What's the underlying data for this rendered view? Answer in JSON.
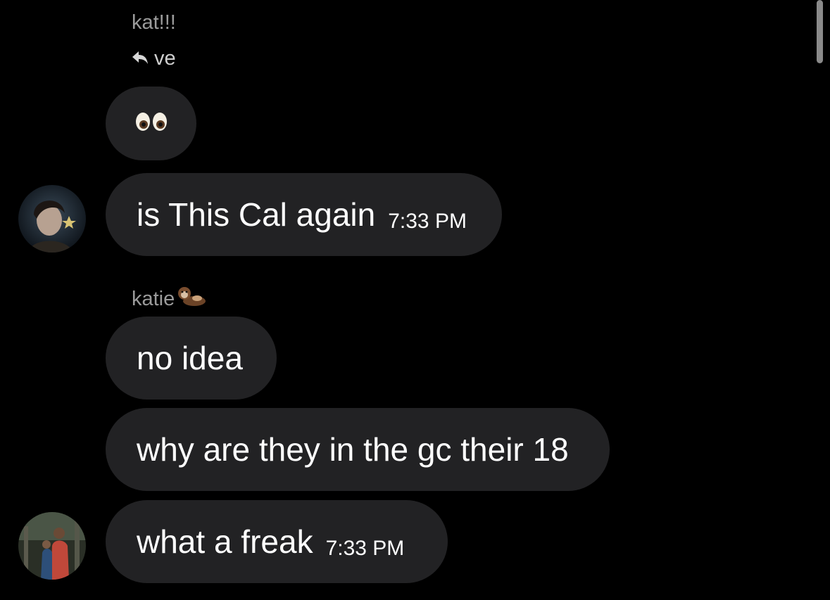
{
  "messages": [
    {
      "sender": "kat!!!",
      "reply_to": "ve",
      "reply_icon": "reply-arrow-icon",
      "text": "👀"
    },
    {
      "text": "is This Cal again",
      "time": "7:33 PM"
    },
    {
      "sender": "katie",
      "sender_emoji": "🦦",
      "text": "no idea"
    },
    {
      "text": "why are they in the gc their 18"
    },
    {
      "text": "what a freak",
      "time": "7:33 PM"
    }
  ]
}
